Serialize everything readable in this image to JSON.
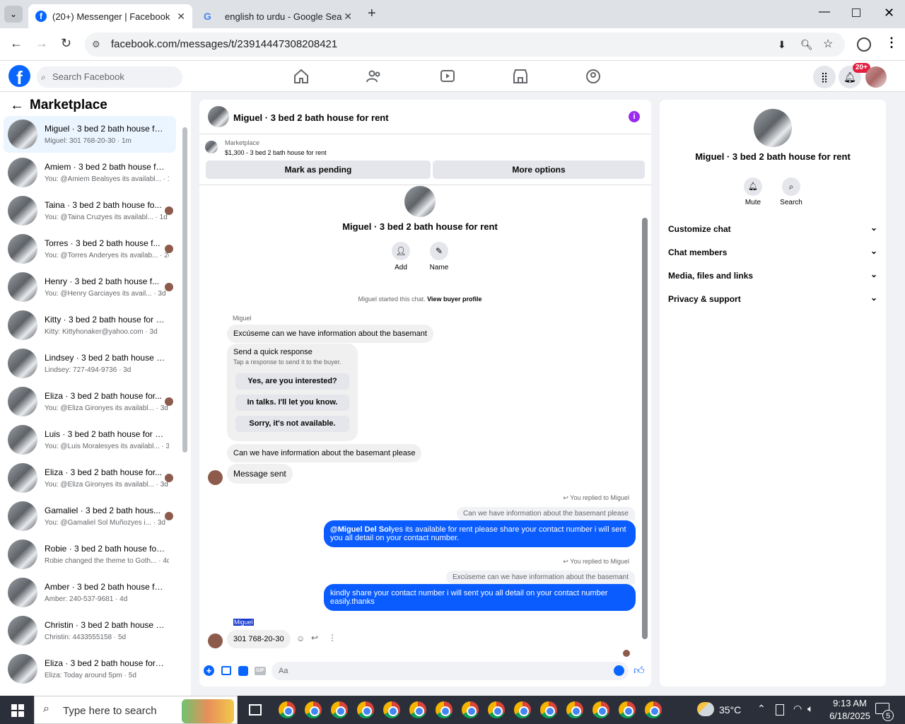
{
  "browser": {
    "tabs": [
      {
        "label": "(20+) Messenger | Facebook"
      },
      {
        "label": "english to urdu - Google Search"
      }
    ],
    "url": "facebook.com/messages/t/23914447308208421"
  },
  "header": {
    "search_placeholder": "Search Facebook",
    "notification_badge": "20+"
  },
  "sidebar": {
    "title": "Marketplace",
    "items": [
      {
        "title": "Miguel · 3 bed 2 bath house for...",
        "sub": "Miguel: 301 768-20-30 · 1m"
      },
      {
        "title": "Amiem · 3 bed 2 bath house for...",
        "sub": "You: @Amiem Bealsyes its availabl... · 1d"
      },
      {
        "title": "Taina · 3 bed 2 bath house fo...",
        "sub": "You: @Taina Cruzyes its availabl... · 1d"
      },
      {
        "title": "Torres · 3 bed 2 bath house f...",
        "sub": "You: @Torres Anderyes its availab... · 2d"
      },
      {
        "title": "Henry · 3 bed 2 bath house f...",
        "sub": "You: @Henry Garciayes its avail... · 3d"
      },
      {
        "title": "Kitty · 3 bed 2 bath house for re...",
        "sub": "Kitty: Kittyhonaker@yahoo.com · 3d"
      },
      {
        "title": "Lindsey · 3 bed 2 bath house fo...",
        "sub": "Lindsey: 727-494-9736 · 3d"
      },
      {
        "title": "Eliza · 3 bed 2 bath house for...",
        "sub": "You: @Eliza Gironyes its availabl... · 3d"
      },
      {
        "title": "Luis · 3 bed 2 bath house for rent",
        "sub": "You: @Luis Moralesyes its availabl... · 3d"
      },
      {
        "title": "Eliza · 3 bed 2 bath house for...",
        "sub": "You: @Eliza Gironyes its availabl... · 3d"
      },
      {
        "title": "Gamaliel · 3 bed 2 bath hous...",
        "sub": "You: @Gamaliel Sol Muñozyes i... · 3d"
      },
      {
        "title": "Robie · 3 bed 2 bath house for r...",
        "sub": "Robie changed the theme to Goth... · 4d"
      },
      {
        "title": "Amber · 3 bed 2 bath house for...",
        "sub": "Amber: 240-537-9681 · 4d"
      },
      {
        "title": "Christin · 3 bed 2 bath house fo...",
        "sub": "Christin: 4433555158 · 5d"
      },
      {
        "title": "Eliza · 3 bed 2 bath house for re...",
        "sub": "Eliza: Today around 5pm · 5d"
      }
    ]
  },
  "chat": {
    "title": "Miguel · 3 bed 2 bath house for rent",
    "listing_label": "Marketplace",
    "listing_detail": "$1,300 - 3 bed 2 bath house for rent",
    "mark_pending": "Mark as pending",
    "more_options": "More options",
    "center_title": "Miguel · 3 bed 2 bath house for rent",
    "add_label": "Add",
    "name_label": "Name",
    "started_text": "Miguel started this chat.",
    "view_profile": "View buyer profile",
    "sender_name": "Miguel",
    "msg1": "Excúseme can we have information about the basemant",
    "quick_title": "Send a quick response",
    "quick_sub": "Tap a response to send it to the buyer.",
    "quick1": "Yes, are you interested?",
    "quick2": "In talks. I'll let you know.",
    "quick3": "Sorry, it's not available.",
    "msg2": "Can we have information about the basemant  please",
    "msg3": "Message sent",
    "replied1": "You replied to Miguel",
    "quoted1": "Can we have information about the basemant  please",
    "reply1_mention": "@Miguel Del Sol",
    "reply1_text": "yes its available for rent please share your contact number i will sent you all detail on your contact number.",
    "replied2": "You replied to Miguel",
    "quoted2": "Excúseme can we have information about the basemant",
    "reply2_text": "kindly share your contact number i will sent you all detail on your contact number easily.thanks",
    "last_sender": "Miguel",
    "last_msg": "301 768-20-30",
    "composer_placeholder": "Aa"
  },
  "info_panel": {
    "title": "Miguel · 3 bed 2 bath house for rent",
    "mute": "Mute",
    "search": "Search",
    "rows": [
      "Customize chat",
      "Chat members",
      "Media, files and links",
      "Privacy & support"
    ]
  },
  "taskbar": {
    "search_placeholder": "Type here to search",
    "temperature": "35°C",
    "time": "9:13 AM",
    "date": "6/18/2025",
    "notif_count": "5"
  },
  "colors": {
    "fb_blue": "#0866ff",
    "bubble_blue": "#0a5cff",
    "accent_purple": "#9b2bf0"
  }
}
